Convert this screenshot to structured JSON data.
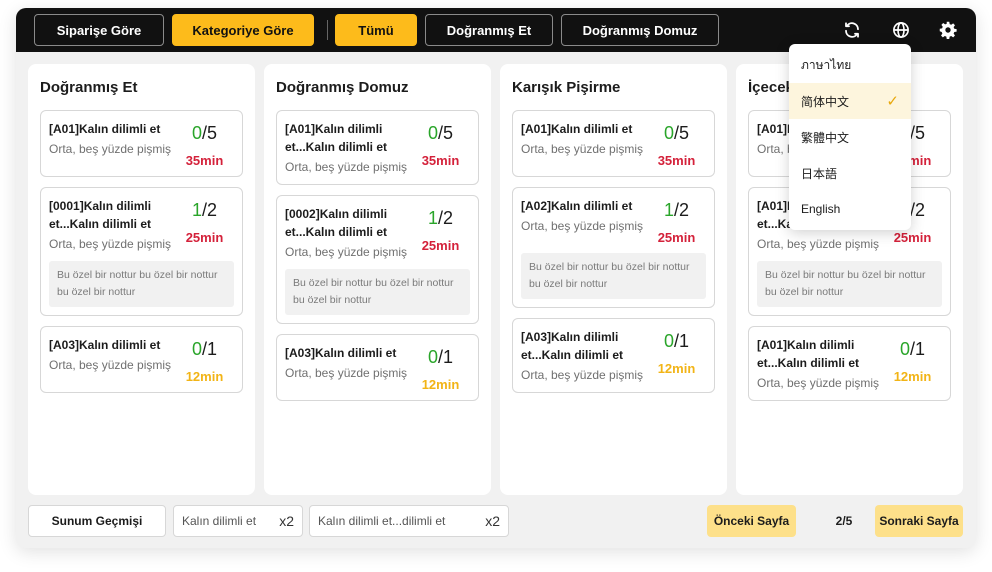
{
  "topbar": {
    "tabs": [
      {
        "label": "Siparişe Göre",
        "active": false
      },
      {
        "label": "Kategoriye Göre",
        "active": true
      }
    ],
    "filters": [
      {
        "label": "Tümü",
        "active": true
      },
      {
        "label": "Doğranmış Et",
        "active": false
      },
      {
        "label": "Doğranmış Domuz",
        "active": false
      }
    ],
    "icons": [
      "refresh-icon",
      "globe-icon",
      "gear-icon"
    ]
  },
  "language_menu": {
    "items": [
      {
        "label": "ภาษาไทย",
        "selected": false
      },
      {
        "label": "简体中文",
        "selected": true
      },
      {
        "label": "繁體中文",
        "selected": false
      },
      {
        "label": "日本語",
        "selected": false
      },
      {
        "label": "English",
        "selected": false
      }
    ]
  },
  "columns": [
    {
      "title": "Doğranmış Et",
      "cards": [
        {
          "title": "[A01]Kalın dilimli et",
          "sub": "Orta, beş yüzde pişmiş",
          "done": "0",
          "total": "/5",
          "time": "35min",
          "time_color": "red",
          "note": ""
        },
        {
          "title": "[0001]Kalın dilimli et...Kalın dilimli et",
          "sub": "Orta, beş yüzde pişmiş",
          "done": "1",
          "total": "/2",
          "time": "25min",
          "time_color": "red",
          "note": "Bu özel bir nottur bu özel bir nottur bu özel bir nottur"
        },
        {
          "title": "[A03]Kalın dilimli et",
          "sub": "Orta, beş yüzde pişmiş",
          "done": "0",
          "total": "/1",
          "time": "12min",
          "time_color": "yellow",
          "note": ""
        }
      ]
    },
    {
      "title": "Doğranmış Domuz",
      "cards": [
        {
          "title": "[A01]Kalın dilimli et...Kalın dilimli et",
          "sub": "Orta, beş yüzde pişmiş",
          "done": "0",
          "total": "/5",
          "time": "35min",
          "time_color": "red",
          "note": ""
        },
        {
          "title": "[0002]Kalın dilimli et...Kalın dilimli et",
          "sub": "Orta, beş yüzde pişmiş",
          "done": "1",
          "total": "/2",
          "time": "25min",
          "time_color": "red",
          "note": "Bu özel bir nottur bu özel bir nottur bu özel bir nottur"
        },
        {
          "title": "[A03]Kalın dilimli et",
          "sub": "Orta, beş yüzde pişmiş",
          "done": "0",
          "total": "/1",
          "time": "12min",
          "time_color": "yellow",
          "note": ""
        }
      ]
    },
    {
      "title": "Karışık Pişirme",
      "cards": [
        {
          "title": "[A01]Kalın dilimli et",
          "sub": "Orta, beş yüzde pişmiş",
          "done": "0",
          "total": "/5",
          "time": "35min",
          "time_color": "red",
          "note": ""
        },
        {
          "title": "[A02]Kalın dilimli et",
          "sub": "Orta, beş yüzde pişmiş",
          "done": "1",
          "total": "/2",
          "time": "25min",
          "time_color": "red",
          "note": "Bu özel bir nottur bu özel bir nottur bu özel bir nottur"
        },
        {
          "title": "[A03]Kalın dilimli et...Kalın dilimli et",
          "sub": "Orta, beş yüzde pişmiş",
          "done": "0",
          "total": "/1",
          "time": "12min",
          "time_color": "yellow",
          "note": ""
        }
      ]
    },
    {
      "title": "İçecekler",
      "cards": [
        {
          "title": "[A01]Kalın dilimli et",
          "sub": "Orta, beş yüzde pişmiş",
          "done": "0",
          "total": "/5",
          "time": "35min",
          "time_color": "red",
          "note": ""
        },
        {
          "title": "[A01]Kalın dilimli et...Kalın dilimli et",
          "sub": "Orta, beş yüzde pişmiş",
          "done": "1",
          "total": "/2",
          "time": "25min",
          "time_color": "red",
          "note": "Bu özel bir nottur bu özel bir nottur bu özel bir nottur"
        },
        {
          "title": "[A01]Kalın dilimli et...Kalın dilimli et",
          "sub": "Orta, beş yüzde pişmiş",
          "done": "0",
          "total": "/1",
          "time": "12min",
          "time_color": "yellow",
          "note": ""
        }
      ]
    }
  ],
  "bottombar": {
    "history_label": "Sunum Geçmişi",
    "chips": [
      {
        "label": "Kalın dilimli et",
        "count": "x2"
      },
      {
        "label": "Kalın dilimli et...dilimli et",
        "count": "x2"
      }
    ],
    "prev_label": "Önceki Sayfa",
    "page_info": "2/5",
    "next_label": "Sonraki Sayfa"
  },
  "colors": {
    "accent": "#fdbb1b",
    "done_green": "#2aa52a",
    "time_red": "#d4213a",
    "time_yellow": "#f2b416"
  }
}
